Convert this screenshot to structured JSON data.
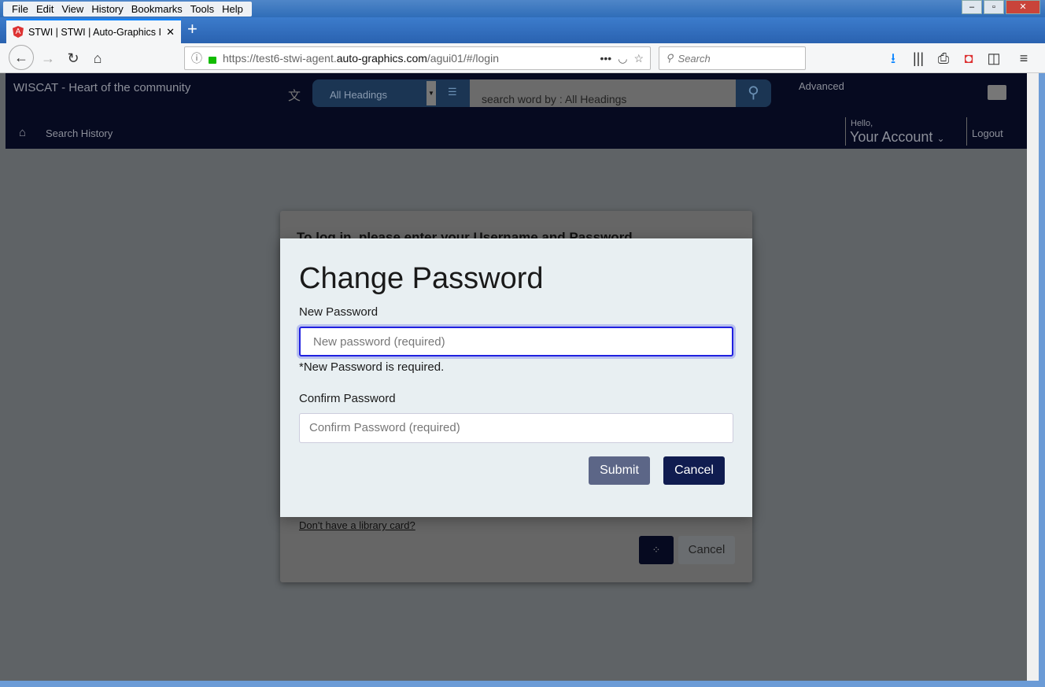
{
  "browser": {
    "menu": [
      "File",
      "Edit",
      "View",
      "History",
      "Bookmarks",
      "Tools",
      "Help"
    ],
    "tab_title": "STWI | STWI | Auto-Graphics Inc",
    "url_prefix": "https://test6-stwi-agent.",
    "url_domain": "auto-graphics.com",
    "url_suffix": "/agui01/#/login",
    "search_placeholder": "Search"
  },
  "header": {
    "site_title": "WISCAT - Heart of the community",
    "search_type": "All Headings",
    "search_placeholder": "search word by : All Headings",
    "advanced": "Advanced",
    "search_history": "Search History",
    "hello": "Hello,",
    "account": "Your Account",
    "logout": "Logout"
  },
  "login_card": {
    "title": "To log in, please enter your Username and Password",
    "link": "Don't have a library card?",
    "cancel": "Cancel"
  },
  "modal": {
    "title": "Change Password",
    "new_label": "New Password",
    "new_placeholder": "New password (required)",
    "error": "*New Password is required.",
    "confirm_label": "Confirm Password",
    "confirm_placeholder": "Confirm Password (required)",
    "submit": "Submit",
    "cancel": "Cancel"
  },
  "colors": {
    "header_bg": "#060a20",
    "submit": "#5c6687",
    "cancel": "#101c50",
    "focus_border": "#2020e0"
  }
}
